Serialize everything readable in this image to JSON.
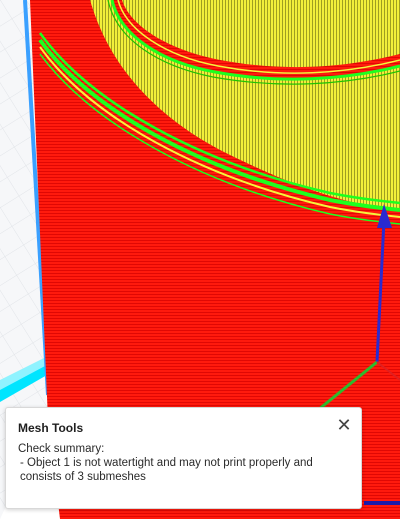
{
  "viewport": {
    "colors": {
      "background": "#ffffff",
      "grid_line": "#e3e6ea",
      "build_plate_edge": "#dfe3e8",
      "wall": "#ff1a0d",
      "wall_line": "#c80000",
      "top_infill": "#f2ef3a",
      "top_infill_line": "#8a8a1a",
      "perimeter_green": "#1eff1e",
      "perimeter_yellow": "#f4f43c",
      "axis_x": "#e02020",
      "axis_y": "#2dbb2d",
      "axis_z": "#2a2ad0",
      "object_outline": "#3aa0ff",
      "support_cyan": "#00e5ff"
    }
  },
  "message": {
    "title": "Mesh Tools",
    "close_glyph": "✕",
    "summary_label": "Check summary:",
    "bullet": "-",
    "items": [
      "Object 1 is not watertight and may not print properly and consists of 3 submeshes"
    ]
  }
}
